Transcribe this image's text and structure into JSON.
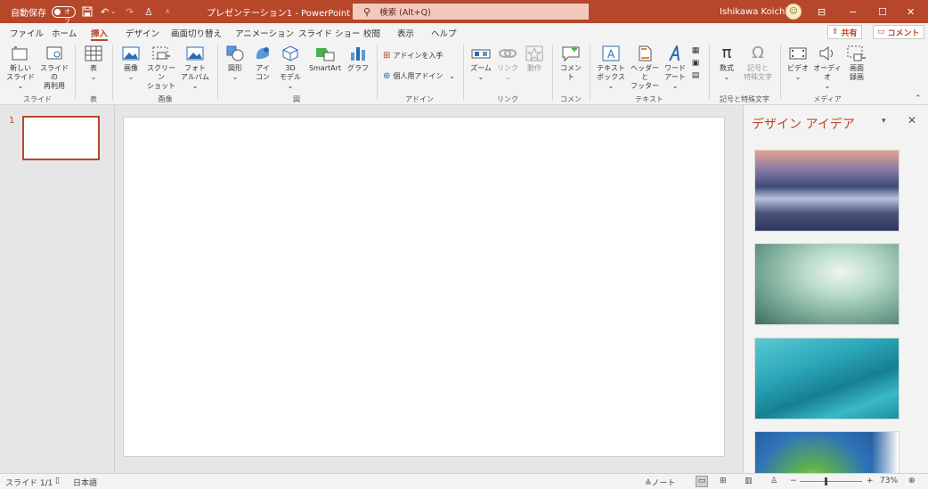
{
  "titlebar": {
    "autosave_label": "自動保存",
    "autosave_state": "オフ",
    "doc_title": "プレゼンテーション1 - PowerPoint",
    "search_placeholder": "検索 (Alt+Q)",
    "user_name": "Ishikawa Koichi",
    "avatar_glyph": "☺",
    "icons": {
      "save": "save-icon",
      "undo": "undo-icon",
      "redo": "redo-icon",
      "present": "present-icon",
      "customize": "qat-customize-icon"
    },
    "colors": {
      "bar": "#b7472a"
    }
  },
  "tabs": [
    {
      "label": "ファイル"
    },
    {
      "label": "ホーム"
    },
    {
      "label": "挿入",
      "active": true
    },
    {
      "label": "デザイン"
    },
    {
      "label": "画面切り替え"
    },
    {
      "label": "アニメーション"
    },
    {
      "label": "スライド ショー"
    },
    {
      "label": "校閲"
    },
    {
      "label": "表示"
    },
    {
      "label": "ヘルプ"
    }
  ],
  "top_buttons": {
    "share": "共有",
    "comment": "コメント"
  },
  "ribbon": {
    "groups": {
      "slides": "スライド",
      "table": "表",
      "images": "画像",
      "illustrations": "図",
      "addins": "アドイン",
      "links": "リンク",
      "comments": "コメント",
      "text": "テキスト",
      "symbols": "記号と特殊文字",
      "media": "メディア"
    },
    "buttons": {
      "new_slide_1": "新しい",
      "new_slide_2": "スライド",
      "reuse_1": "スライドの",
      "reuse_2": "再利用",
      "table": "表",
      "pictures": "画像",
      "screenshot_1": "スクリーン",
      "screenshot_2": "ショット",
      "photo_1": "フォト",
      "photo_2": "アルバム",
      "shapes": "図形",
      "icons_1": "アイ",
      "icons_2": "コン",
      "model3d_1": "3D",
      "model3d_2": "モデル",
      "smartart": "SmartArt",
      "chart": "グラフ",
      "get_addins": "アドインを入手",
      "my_addins": "個人用アドイン",
      "zoom": "ズーム",
      "link": "リンク",
      "action": "動作",
      "comment": "コメント",
      "textbox_1": "テキスト",
      "textbox_2": "ボックス",
      "header_1": "ヘッダーと",
      "header_2": "フッター",
      "wordart_1": "ワード",
      "wordart_2": "アート",
      "equation": "数式",
      "symbol_1": "記号と",
      "symbol_2": "特殊文字",
      "video": "ビデオ",
      "audio": "オーディオ",
      "screen_rec_1": "画面",
      "screen_rec_2": "録画"
    }
  },
  "thumbnails": {
    "slide_number": "1"
  },
  "design_pane": {
    "title": "デザイン アイデア",
    "ideas": [
      "design-idea-mountains",
      "design-idea-frost-flowers",
      "design-idea-teal-fabric",
      "design-idea-bokeh"
    ]
  },
  "statusbar": {
    "slide_info": "スライド 1/1",
    "language": "日本語",
    "notes": "ノート",
    "zoom_level": "73%"
  }
}
